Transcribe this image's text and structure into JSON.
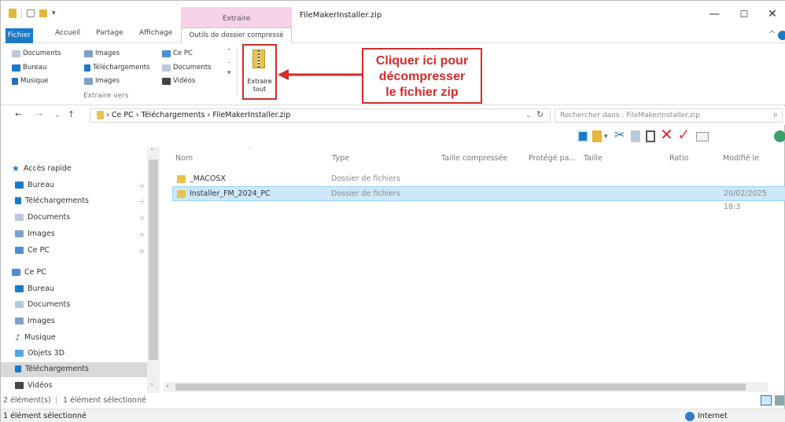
{
  "window": {
    "title": "FileMakerInstaller.zip",
    "context_tab": "Extraire",
    "minimize": "—",
    "maximize": "☐",
    "close": "✕"
  },
  "tabs": {
    "file": "Fichier",
    "home": "Accueil",
    "share": "Partage",
    "view": "Affichage",
    "tools": "Outils de dossier compressé"
  },
  "ribbon": {
    "col1": [
      "Documents",
      "Bureau",
      "Musique"
    ],
    "col2": [
      "Images",
      "Téléchargements",
      "Images"
    ],
    "col3": [
      "Ce PC",
      "Documents",
      "Vidéos"
    ],
    "group_label": "Extraire vers",
    "extract_all": "Extraire tout"
  },
  "callout": {
    "line1": "Cliquer ici pour",
    "line2": "décompresser",
    "line3": "le fichier zip"
  },
  "address": {
    "path": "›  Ce PC  ›  Téléchargements  ›  FileMakerInstaller.zip",
    "search_placeholder": "Rechercher dans : FileMakerInstaller.zip"
  },
  "nav": {
    "quick_access": "Accès rapide",
    "quick_items": [
      "Bureau",
      "Téléchargements",
      "Documents",
      "Images",
      "Ce PC"
    ],
    "this_pc": "Ce PC",
    "pc_items": [
      "Bureau",
      "Documents",
      "Images",
      "Musique",
      "Objets 3D",
      "Téléchargements",
      "Vidéos"
    ]
  },
  "columns": {
    "name": "Nom",
    "type": "Type",
    "compressed": "Taille compressée",
    "protected": "Protégé pa...",
    "size": "Taille",
    "ratio": "Ratio",
    "modified": "Modifié le"
  },
  "files": [
    {
      "name": "_MACOSX",
      "type": "Dossier de fichiers",
      "modified": ""
    },
    {
      "name": "Installer_FM_2024_PC",
      "type": "Dossier de fichiers",
      "modified": "20/02/2025 18:3"
    }
  ],
  "status": {
    "count": "2 élément(s)",
    "selected": "1 élément sélectionné",
    "bottom_left": "1 élément sélectionné",
    "zone": "Internet"
  },
  "colors": {
    "accent": "#1979ca",
    "callout": "#d42b2b",
    "selection": "#cce8ff",
    "context_tab": "#f6d1e8"
  }
}
